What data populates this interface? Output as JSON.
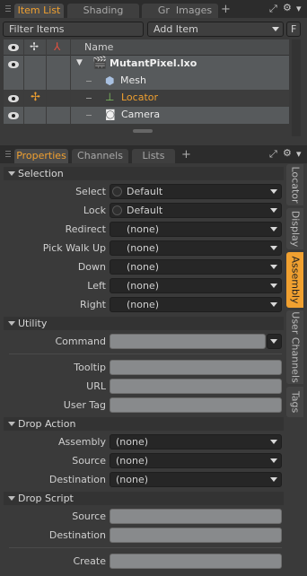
{
  "top_tabs": [
    {
      "label": "Item List",
      "active": true
    },
    {
      "label": "Shading",
      "active": false
    },
    {
      "label": "Groups",
      "active": false
    },
    {
      "label": "Images",
      "active": false
    }
  ],
  "plus_label": "+",
  "filter": {
    "placeholder": "Filter Items"
  },
  "add_item": {
    "label": "Add Item"
  },
  "f_button": "F",
  "columns": {
    "name": "Name"
  },
  "items": [
    {
      "name": "MutantPixel.lxo",
      "icon": "clapper-icon",
      "bold": true,
      "selected": false
    },
    {
      "name": "Mesh",
      "icon": "mesh-cube-icon",
      "bold": false,
      "selected": false
    },
    {
      "name": "Locator",
      "icon": "locator-icon",
      "bold": false,
      "selected": true
    },
    {
      "name": "Camera",
      "icon": "camera-icon",
      "bold": false,
      "selected": false
    }
  ],
  "prop_tabs": [
    {
      "label": "Properties",
      "active": true
    },
    {
      "label": "Channels",
      "active": false
    },
    {
      "label": "Lists",
      "active": false
    }
  ],
  "side_tabs": [
    {
      "label": "Locator",
      "active": false
    },
    {
      "label": "Display",
      "active": false
    },
    {
      "label": "Assembly",
      "active": true
    },
    {
      "label": "User Channels",
      "active": false
    },
    {
      "label": "Tags",
      "active": false
    }
  ],
  "sections": {
    "selection": "Selection",
    "utility": "Utility",
    "drop_action": "Drop Action",
    "drop_script": "Drop Script"
  },
  "selection_fields": [
    {
      "label": "Select",
      "value": "Default",
      "has_toggle": true
    },
    {
      "label": "Lock",
      "value": "Default",
      "has_toggle": true
    },
    {
      "label": "Redirect",
      "value": "(none)",
      "has_toggle": false
    },
    {
      "label": "Pick Walk Up",
      "value": "(none)",
      "has_toggle": false
    },
    {
      "label": "Down",
      "value": "(none)",
      "has_toggle": false
    },
    {
      "label": "Left",
      "value": "(none)",
      "has_toggle": false
    },
    {
      "label": "Right",
      "value": "(none)",
      "has_toggle": false
    }
  ],
  "utility": {
    "command_label": "Command",
    "tooltip_label": "Tooltip",
    "url_label": "URL",
    "user_tag_label": "User Tag"
  },
  "drop_action_fields": [
    {
      "label": "Assembly",
      "value": "(none)"
    },
    {
      "label": "Source",
      "value": "(none)"
    },
    {
      "label": "Destination",
      "value": "(none)"
    }
  ],
  "drop_script": {
    "source_label": "Source",
    "destination_label": "Destination"
  },
  "create_label": "Create",
  "colors": {
    "accent": "#f0a030",
    "panel": "#3a3a3a",
    "field": "#262626"
  }
}
